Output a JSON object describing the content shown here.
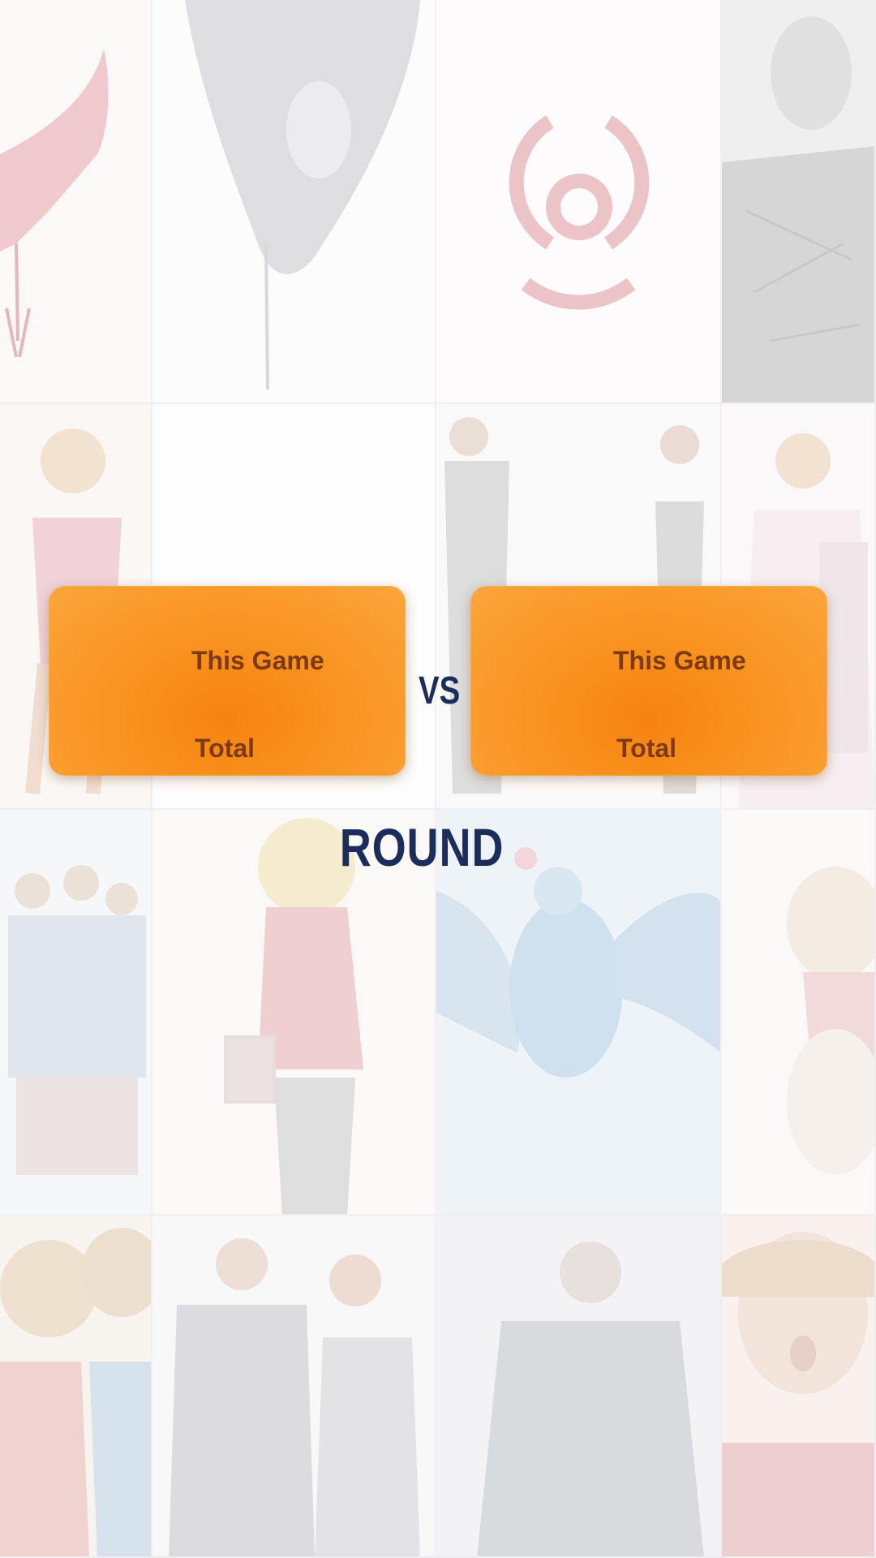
{
  "scoreboard": {
    "player_one": {
      "this_game_label": "This Game",
      "total_label": "Total"
    },
    "player_two": {
      "this_game_label": "This Game",
      "total_label": "Total"
    },
    "vs_label": "VS",
    "round_label": "ROUND"
  },
  "colors": {
    "panel_orange": "#f99321",
    "panel_text": "#7c3a0e",
    "heading_navy": "#1c2d5c"
  }
}
